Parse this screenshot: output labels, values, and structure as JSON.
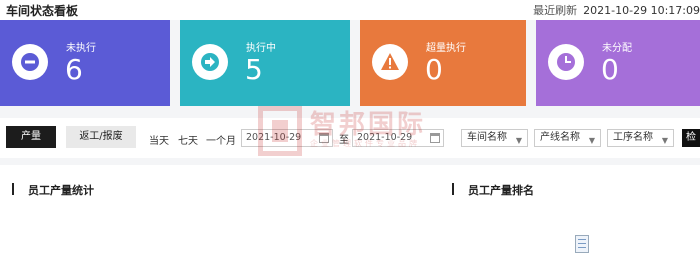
{
  "header": {
    "title": "车间状态看板",
    "refresh_label": "最近刷新",
    "refresh_time": "2021-10-29 10:17:09"
  },
  "cards": [
    {
      "label": "未执行",
      "value": "6",
      "color": "#5b5bd6",
      "icon": "minus-circle-icon"
    },
    {
      "label": "执行中",
      "value": "5",
      "color": "#2bb4c2",
      "icon": "arrow-right-icon"
    },
    {
      "label": "超量执行",
      "value": "0",
      "color": "#e8793d",
      "icon": "warning-icon"
    },
    {
      "label": "未分配",
      "value": "0",
      "color": "#a56fd9",
      "icon": "clock-icon"
    }
  ],
  "filters": {
    "tabs": [
      "产量",
      "返工/报废"
    ],
    "quick_ranges": [
      "当天",
      "七天",
      "一个月"
    ],
    "date_start": "2021-10-29",
    "date_separator": "至",
    "date_end": "2021-10-29",
    "selects": [
      "车间名称",
      "产线名称",
      "工序名称"
    ],
    "search_label": "检索"
  },
  "panels": {
    "left_title": "员工产量统计",
    "right_title": "员工产量排名"
  },
  "watermark": {
    "text": "智邦国际",
    "subtext": "企业管理软件专业品牌"
  }
}
